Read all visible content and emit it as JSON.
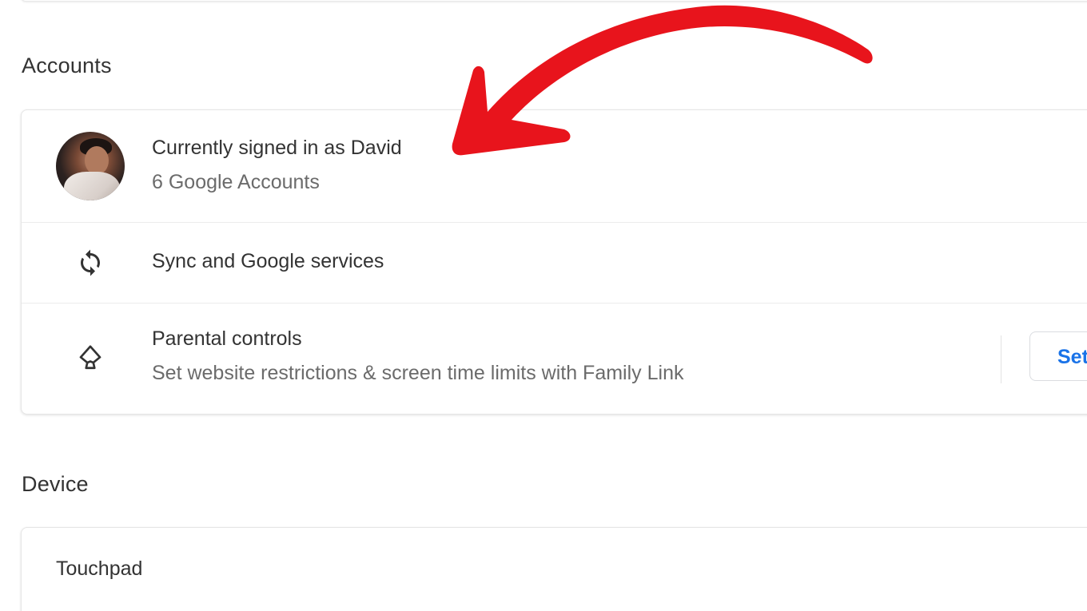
{
  "accounts": {
    "title": "Accounts",
    "signed_in": {
      "primary": "Currently signed in as David",
      "secondary": "6 Google Accounts"
    },
    "sync": {
      "label": "Sync and Google services",
      "icon": "sync-icon"
    },
    "parental": {
      "label": "Parental controls",
      "description": "Set website restrictions & screen time limits with Family Link",
      "icon": "parental-controls-icon",
      "button_label": "Set up"
    }
  },
  "device": {
    "title": "Device",
    "touchpad": {
      "label": "Touchpad"
    }
  },
  "annotation": {
    "arrow_color": "#e8141c"
  },
  "colors": {
    "accent": "#1a73e8",
    "text_primary": "#333333",
    "text_secondary": "#6b6b6b"
  }
}
